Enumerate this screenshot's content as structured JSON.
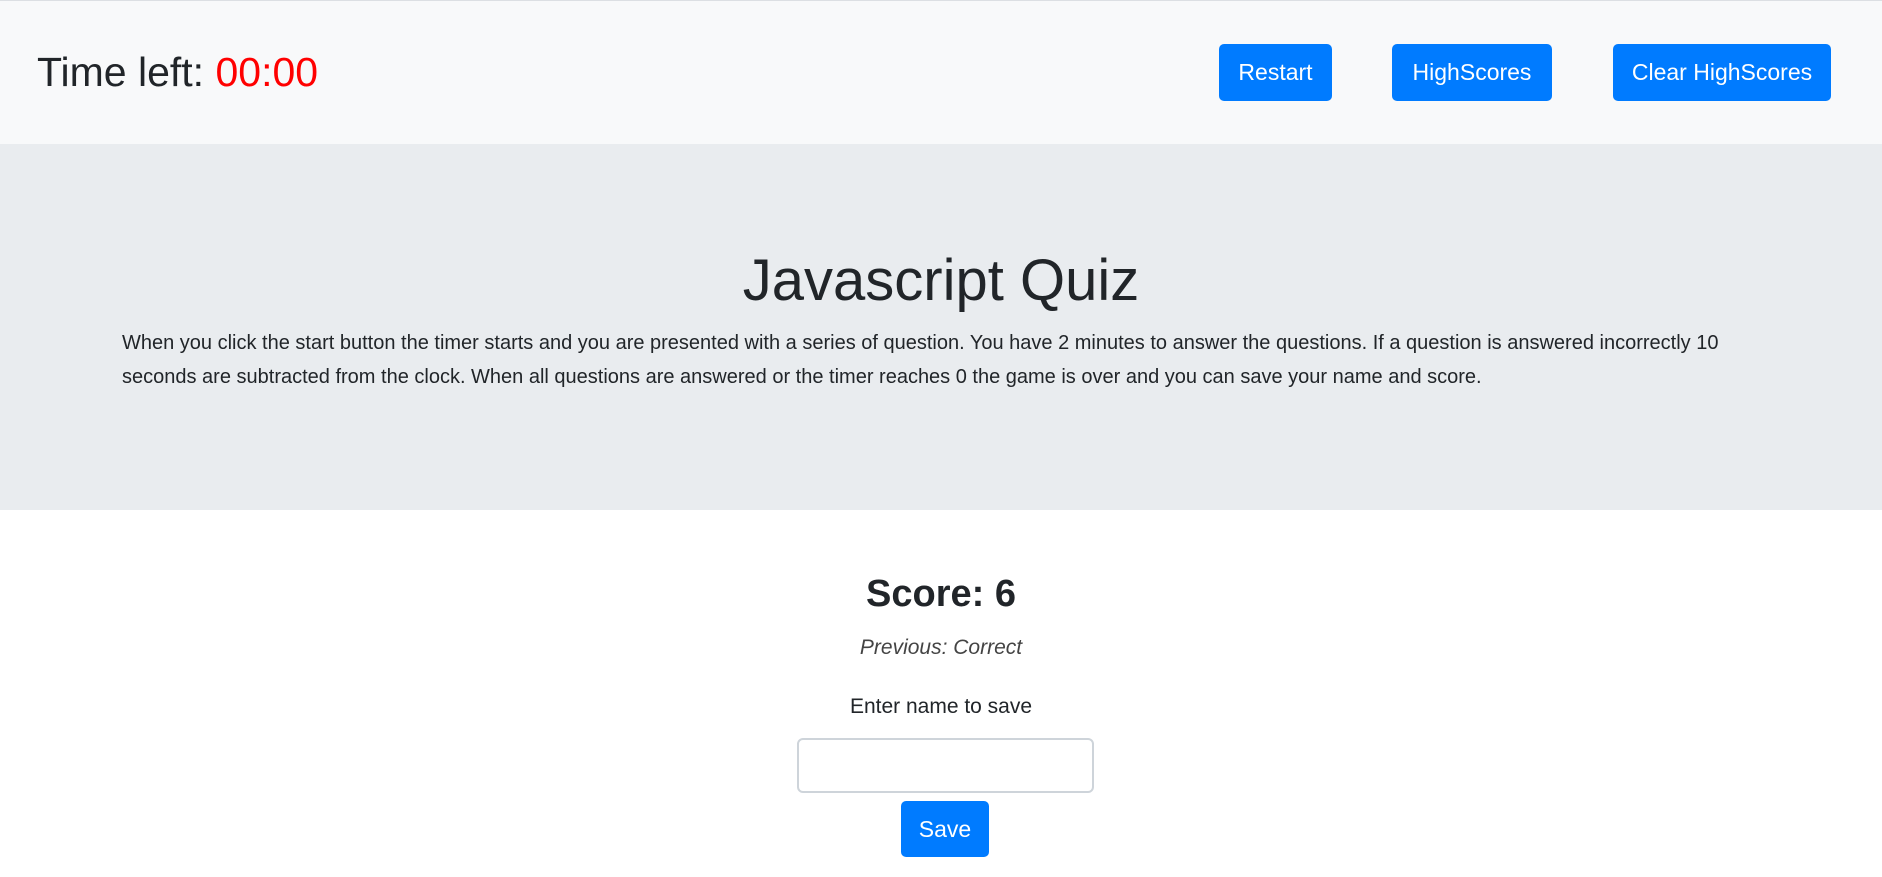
{
  "header": {
    "timer_label": "Time left:",
    "timer_value": "00:00",
    "buttons": {
      "restart": "Restart",
      "highscores": "HighScores",
      "clear": "Clear HighScores"
    }
  },
  "jumbotron": {
    "title": "Javascript Quiz",
    "description": "When you click the start button the timer starts and you are presented with a series of question. You have 2 minutes to answer the questions. If a question is answered incorrectly 10 seconds are subtracted from the clock. When all questions are answered or the timer reaches 0 the game is over and you can save your name and score."
  },
  "result": {
    "score": "Score: 6",
    "previous": "Previous: Correct",
    "name_label": "Enter name to save",
    "name_value": "",
    "save_label": "Save"
  },
  "colors": {
    "accent": "#007bff",
    "timer": "#ff0000"
  }
}
